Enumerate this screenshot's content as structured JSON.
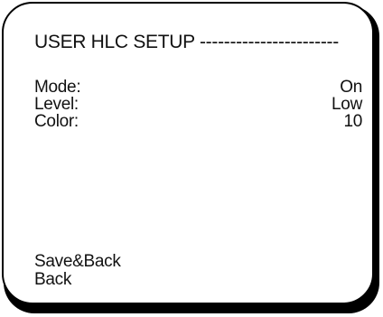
{
  "menu": {
    "title": "USER HLC SETUP -----------------------",
    "items": [
      {
        "label": "Mode:",
        "value": "On"
      },
      {
        "label": "Level:",
        "value": "Low"
      },
      {
        "label": "Color:",
        "value": "10"
      }
    ],
    "actions": {
      "save_back": "Save&Back",
      "back": "Back"
    }
  }
}
